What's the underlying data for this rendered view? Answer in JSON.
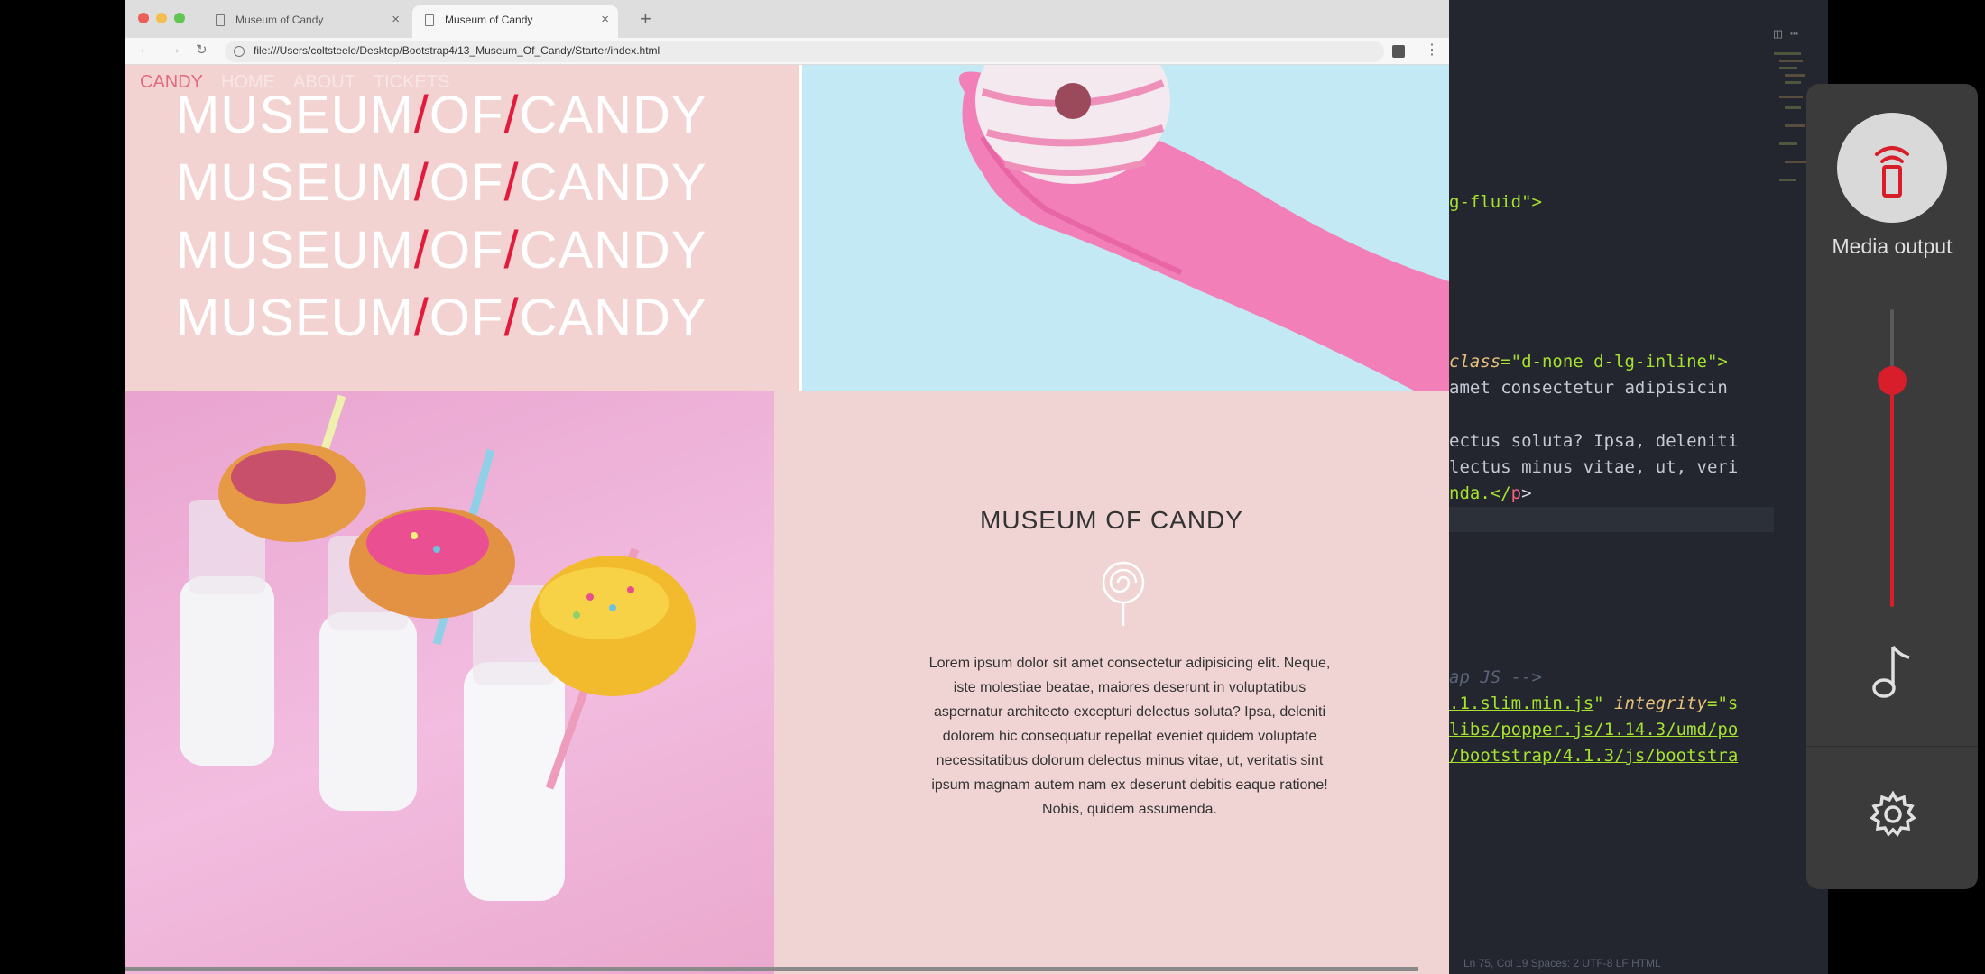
{
  "browser": {
    "tabs": [
      {
        "label": "Museum of Candy",
        "active": false
      },
      {
        "label": "Museum of Candy",
        "active": true
      }
    ],
    "new_tab_label": "+",
    "close_label": "×",
    "url": "file:///Users/coltsteele/Desktop/Bootstrap4/13_Museum_Of_Candy/Starter/index.html"
  },
  "page": {
    "brand": "CANDY",
    "nav_links": [
      "HOME",
      "ABOUT",
      "TICKETS"
    ],
    "hero_title": {
      "part1": "MUSEUM",
      "sep": "/",
      "part2": "OF",
      "part3": "CANDY"
    },
    "hero_repeat": 4,
    "info_title": "MUSEUM OF CANDY",
    "info_body": "Lorem ipsum dolor sit amet consectetur adipisicing elit. Neque, iste molestiae beatae, maiores deserunt in voluptatibus aspernatur architecto excepturi delectus soluta? Ipsa, deleniti dolorem hic consequatur repellat eveniet quidem voluptate necessitatibus dolorum delectus minus vitae, ut, veritatis sint ipsum magnam autem nam ex deserunt debitis eaque ratione! Nobis, quidem assumenda."
  },
  "editor": {
    "lines": {
      "l1": "g-fluid\">",
      "l2a": "class",
      "l2b": "=\"d-none d-lg-inline\">",
      "l3": " amet consectetur adipisicin",
      "l4": "ectus soluta? Ipsa, deleniti",
      "l5": "lectus minus vitae, ut, veri",
      "l6a": "nda.</",
      "l6b": "p",
      "l6c": ">",
      "l7": "ap JS -->",
      "l8a": ".1.slim.min.js",
      "l8b": "\" ",
      "l8c": "integrity",
      "l8d": "=\"s",
      "l9": "libs/popper.js/1.14.3/umd/po",
      "l10": "/bootstrap/4.1.3/js/bootstra"
    },
    "status": "Ln 75, Col 19    Spaces: 2    UTF-8    LF    HTML"
  },
  "media_panel": {
    "label": "Media output",
    "volume_level": 0.76,
    "accent": "#d71e2a"
  }
}
